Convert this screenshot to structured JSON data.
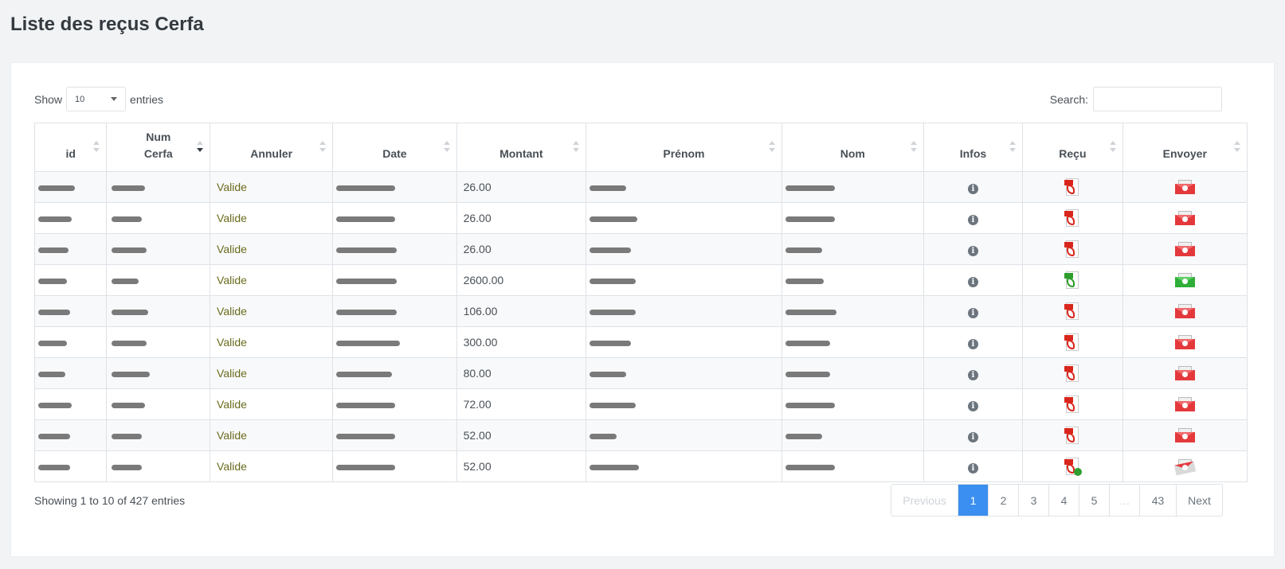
{
  "title": "Liste des reçus Cerfa",
  "length": {
    "show": "Show",
    "value": "10",
    "entries": "entries"
  },
  "search": {
    "label": "Search:",
    "placeholder": ""
  },
  "columns": [
    "id",
    "Num Cerfa",
    "Annuler",
    "Date",
    "Montant",
    "Prénom",
    "Nom",
    "Infos",
    "Reçu",
    "Envoyer"
  ],
  "columns_wrap": {
    "num": "Num",
    "cerfa": "Cerfa"
  },
  "rows": [
    {
      "annuler": "Valide",
      "montant": "26.00",
      "recu": "pdf-red-icon",
      "envoyer": "mail-red-icon"
    },
    {
      "annuler": "Valide",
      "montant": "26.00",
      "recu": "pdf-red-icon",
      "envoyer": "mail-red-icon"
    },
    {
      "annuler": "Valide",
      "montant": "26.00",
      "recu": "pdf-red-icon",
      "envoyer": "mail-red-icon"
    },
    {
      "annuler": "Valide",
      "montant": "2600.00",
      "recu": "pdf-green-icon",
      "envoyer": "mail-green-icon"
    },
    {
      "annuler": "Valide",
      "montant": "106.00",
      "recu": "pdf-red-icon",
      "envoyer": "mail-red-icon"
    },
    {
      "annuler": "Valide",
      "montant": "300.00",
      "recu": "pdf-red-icon",
      "envoyer": "mail-red-icon"
    },
    {
      "annuler": "Valide",
      "montant": "80.00",
      "recu": "pdf-red-icon",
      "envoyer": "mail-red-icon"
    },
    {
      "annuler": "Valide",
      "montant": "72.00",
      "recu": "pdf-red-icon",
      "envoyer": "mail-red-icon"
    },
    {
      "annuler": "Valide",
      "montant": "52.00",
      "recu": "pdf-red-icon",
      "envoyer": "mail-red-icon"
    },
    {
      "annuler": "Valide",
      "montant": "52.00",
      "recu": "pdf-check-icon",
      "envoyer": "mail-sent-icon"
    }
  ],
  "info_icon": "info-icon",
  "footer": {
    "info": "Showing 1 to 10 of 427 entries"
  },
  "pagination": {
    "previous": "Previous",
    "pages": [
      "1",
      "2",
      "3",
      "4",
      "5"
    ],
    "ellipsis": "…",
    "last": "43",
    "next": "Next",
    "active": "1"
  },
  "colors": {
    "accent": "#3b8ff0",
    "valide": "#6b6b1e"
  }
}
